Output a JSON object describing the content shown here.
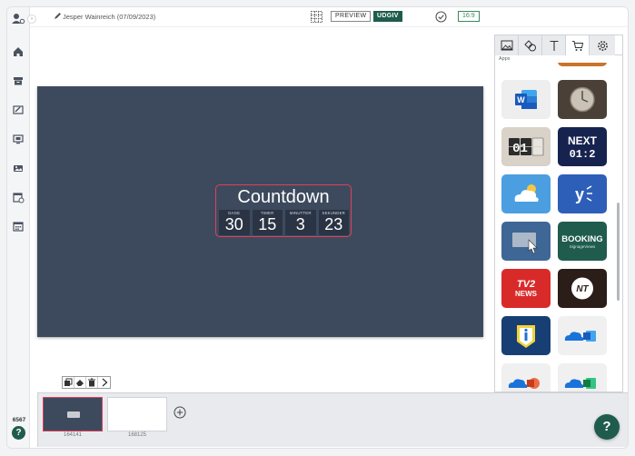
{
  "topbar": {
    "author": "Jesper Wainreich (07/09/2023)",
    "preview_label": "PREVIEW",
    "publish_label": "UDGIV",
    "aspect_ratio": "16:9"
  },
  "countdown": {
    "title": "Countdown",
    "units": [
      {
        "label": "DAGE",
        "value": "30"
      },
      {
        "label": "TIMER",
        "value": "15"
      },
      {
        "label": "MINUTTER",
        "value": "3"
      },
      {
        "label": "SEKUNDER",
        "value": "23"
      }
    ]
  },
  "panel": {
    "section_label": "Apps",
    "apps": {
      "next_lines": [
        "NEXT",
        "01:2"
      ],
      "booking_title": "BOOKING",
      "booking_sub": "SignageViews",
      "tv2_top": "TV2",
      "tv2_bottom": "NEWS",
      "nt": "NT",
      "yammer": "y",
      "word_letter": "W",
      "flip": "01"
    }
  },
  "sidebar": {
    "user_id": "6567",
    "help": "?"
  },
  "slides": [
    {
      "id": "164141"
    },
    {
      "id": "168125"
    }
  ],
  "help_fab": "?",
  "colors": {
    "canvas": "#3d4a5e",
    "accent_green": "#1f5c4d",
    "selection_red": "#e0405a"
  }
}
